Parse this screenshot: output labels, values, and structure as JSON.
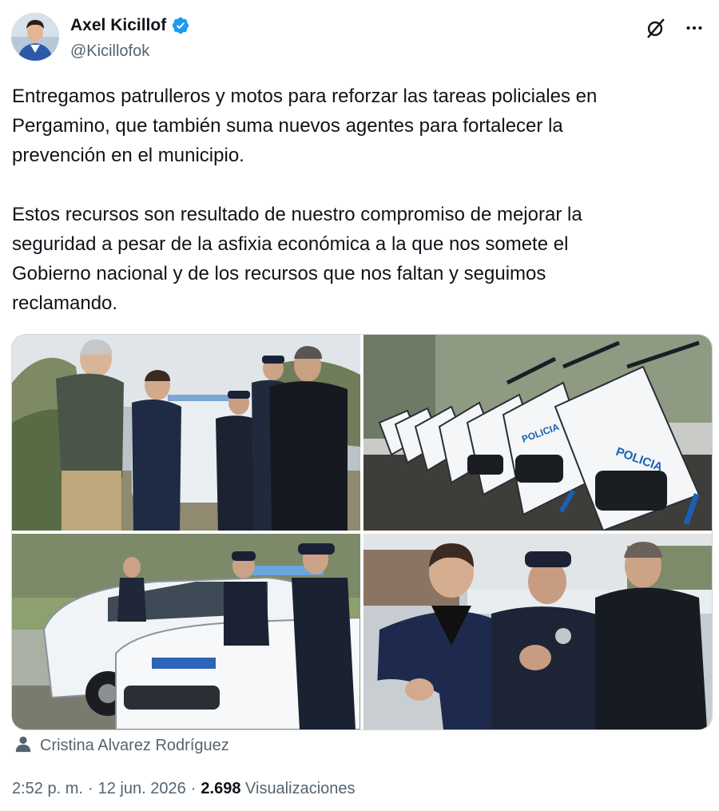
{
  "author": {
    "display_name": "Axel Kicillof",
    "handle": "@Kicillofok",
    "verified": true
  },
  "icons": {
    "verified": "verified-badge-icon",
    "grok": "grok-icon",
    "more": "more-options-icon",
    "person": "person-icon"
  },
  "tweet": {
    "paragraphs": [
      "Entregamos patrulleros y motos para reforzar las tareas policiales en\nPergamino, que también suma nuevos agentes para fortalecer la\nprevención en el municipio.",
      "Estos recursos son resultado de nuestro compromiso de mejorar la\nseguridad a pesar de la asfixia económica a la que nos somete el\nGobierno nacional y de los recursos que nos faltan y seguimos\nreclamando."
    ]
  },
  "media": {
    "photo_count": 4,
    "motorcycle_label": "POLICIA"
  },
  "tagged_user": "Cristina Alvarez Rodríguez",
  "meta": {
    "time": "2:52 p. m.",
    "separator": "·",
    "date": "12 jun. 2026",
    "views_count": "2.698",
    "views_label": "Visualizaciones"
  },
  "colors": {
    "verified_blue": "#1d9bf0",
    "text_primary": "#0f1419",
    "text_secondary": "#536471",
    "border": "#cfd9de"
  }
}
